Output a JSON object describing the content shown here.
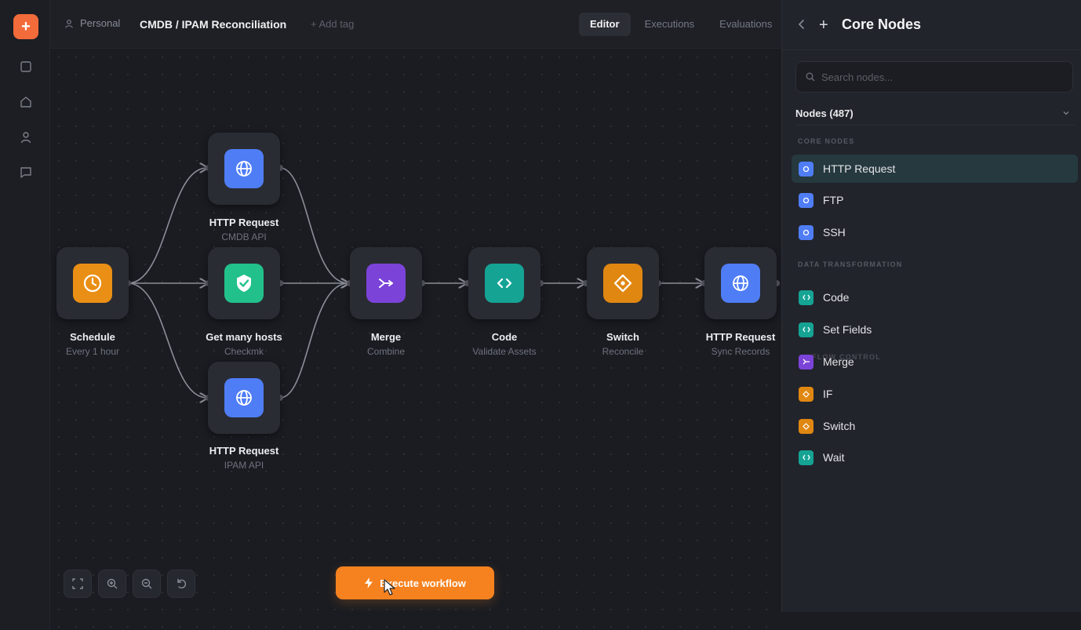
{
  "header": {
    "user_label": "Personal",
    "workflow_title": "CMDB / IPAM Reconciliation",
    "add_tag": "+ Add tag",
    "tabs": [
      "Editor",
      "Executions",
      "Evaluations"
    ]
  },
  "colors": {
    "brand": "#f26b3a",
    "execute": "#f5821f",
    "blue": "#4f7df5",
    "green": "#22c08a",
    "purple": "#7b43d8",
    "teal": "#15a394",
    "orange": "#e08712",
    "amber": "#ea8f15"
  },
  "nodes": [
    {
      "id": "schedule",
      "title": "Schedule",
      "subtitle": "Every 1 hour",
      "icon": "clock-icon"
    },
    {
      "id": "http1",
      "title": "HTTP Request",
      "subtitle": "CMDB API",
      "icon": "globe-icon"
    },
    {
      "id": "hosts",
      "title": "Get many hosts",
      "subtitle": "Checkmk",
      "icon": "check-badge-icon"
    },
    {
      "id": "http2",
      "title": "HTTP Request",
      "subtitle": "IPAM API",
      "icon": "globe-icon"
    },
    {
      "id": "merge",
      "title": "Merge",
      "subtitle": "Combine",
      "icon": "merge-icon"
    },
    {
      "id": "code",
      "title": "Code",
      "subtitle": "Validate Assets",
      "icon": "code-icon"
    },
    {
      "id": "switch",
      "title": "Switch",
      "subtitle": "Reconcile",
      "icon": "switch-icon"
    },
    {
      "id": "http3",
      "title": "HTTP Request",
      "subtitle": "Sync Records",
      "icon": "globe-icon"
    }
  ],
  "execute_label": "Execute workflow",
  "panel": {
    "title": "Core Nodes",
    "search_placeholder": "Search nodes...",
    "nodes_count_label": "Nodes (487)",
    "sections": [
      {
        "label": "CORE NODES",
        "items": [
          {
            "label": "HTTP Request",
            "icon": "globe-icon",
            "active": true
          },
          {
            "label": "FTP",
            "icon": "globe-icon"
          },
          {
            "label": "SSH",
            "icon": "globe-icon"
          }
        ]
      },
      {
        "label": "DATA TRANSFORMATION",
        "items": [
          {
            "label": "Code",
            "icon": "code-icon"
          },
          {
            "label": "Set Fields",
            "icon": "code-icon"
          },
          {
            "label": "Merge",
            "icon": "merge-icon"
          }
        ]
      },
      {
        "label": "FLOW CONTROL",
        "items": [
          {
            "label": "IF",
            "icon": "switch-icon"
          },
          {
            "label": "Switch",
            "icon": "switch-icon"
          },
          {
            "label": "Wait",
            "icon": "code-icon"
          }
        ]
      }
    ]
  }
}
